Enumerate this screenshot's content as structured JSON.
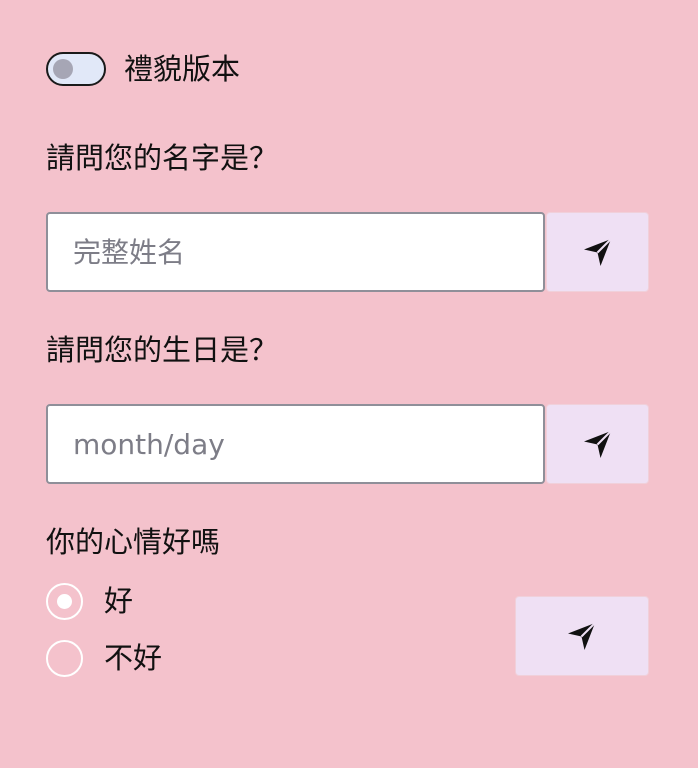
{
  "toggle": {
    "label": "禮貌版本",
    "checked": false
  },
  "name_question": {
    "label": "請問您的名字是？",
    "placeholder": "完整姓名",
    "value": "",
    "send_icon": "send-paper-plane-icon"
  },
  "birthday_question": {
    "label": "請問您的生日是？",
    "placeholder": "month/day",
    "value": "",
    "send_icon": "send-paper-plane-icon"
  },
  "mood_question": {
    "label": "你的心情好嗎",
    "options": [
      {
        "label": "好",
        "selected": true
      },
      {
        "label": "不好",
        "selected": false
      }
    ],
    "send_icon": "send-paper-plane-icon"
  },
  "colors": {
    "background": "#f4c2cc",
    "button_background": "#efe0f4",
    "input_border": "#8f8f99",
    "toggle_background": "#e1e8f8"
  }
}
